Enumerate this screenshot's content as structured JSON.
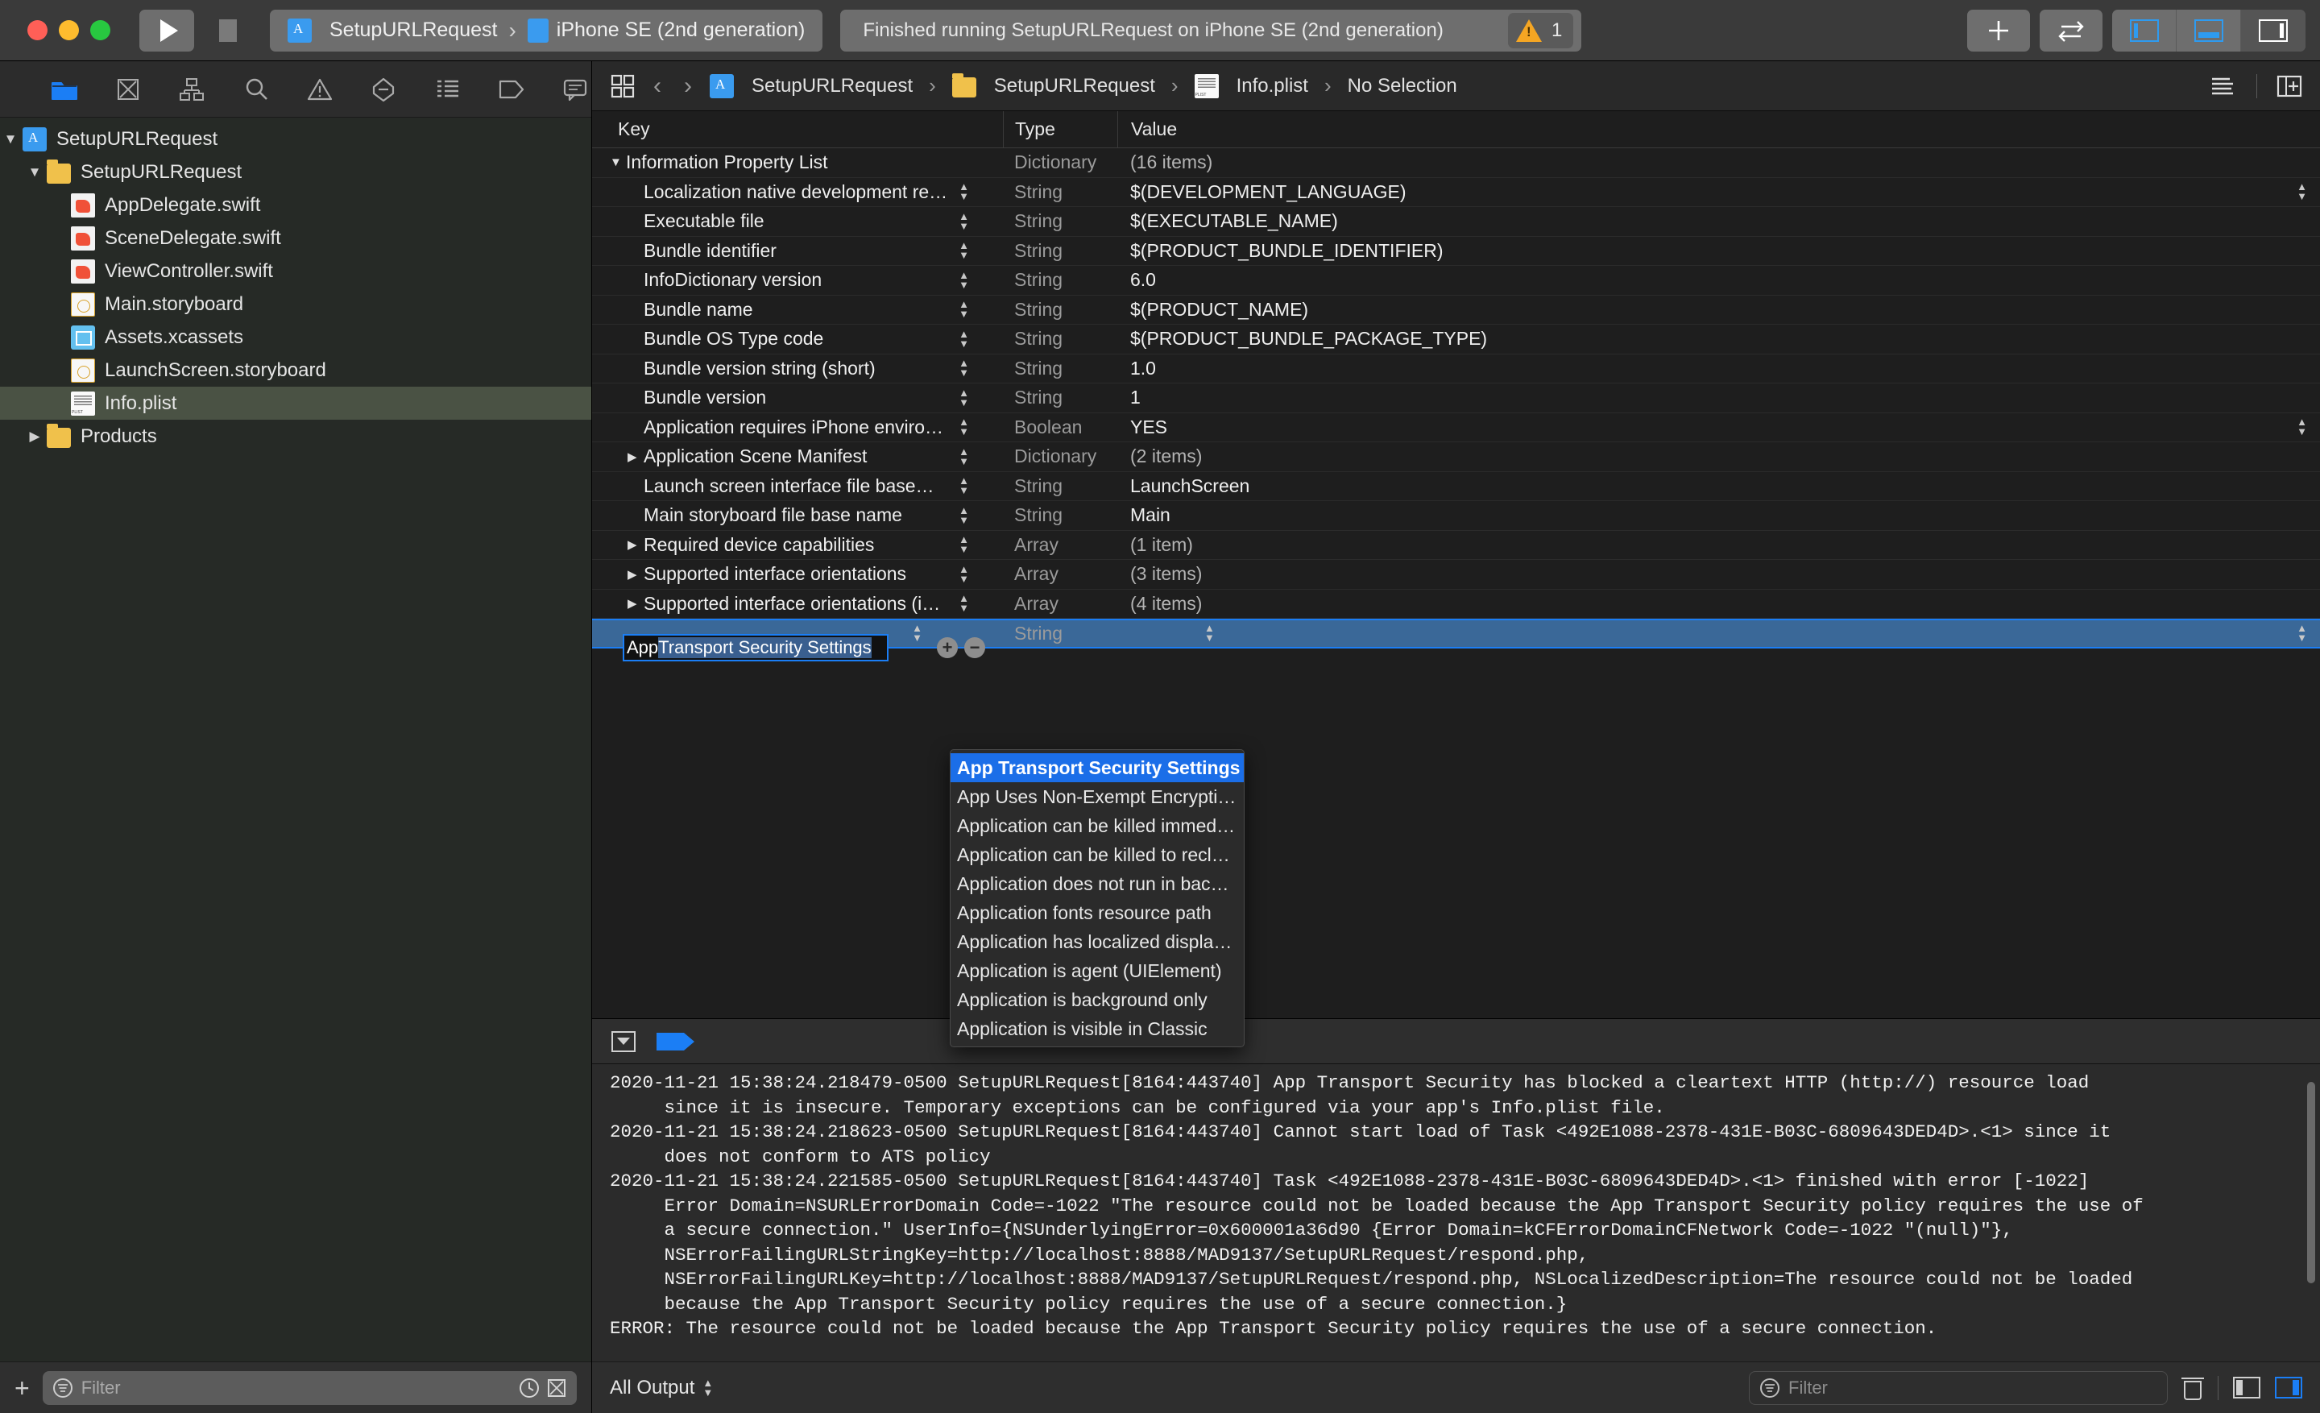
{
  "titlebar": {
    "run_label": "run-button",
    "stop_label": "stop-button",
    "scheme_project": "SetupURLRequest",
    "scheme_separator": "›",
    "scheme_destination": "iPhone SE (2nd generation)",
    "status_text": "Finished running SetupURLRequest on iPhone SE (2nd generation)",
    "warning_count": "1",
    "add_button": "+",
    "toolbar_icons": [
      "plus-icon",
      "swap-icon",
      "left-panel-icon",
      "bottom-panel-icon",
      "right-panel-icon"
    ]
  },
  "navigator": {
    "tabs": [
      "folder-icon",
      "source-control-icon",
      "hierarchy-icon",
      "search-icon",
      "warning-icon",
      "breakpoint-icon",
      "report-icon",
      "tag-icon",
      "comment-icon"
    ],
    "active_tab_index": 0,
    "tree": [
      {
        "label": "SetupURLRequest",
        "icon": "xcodeproj-icon",
        "depth": 0,
        "twisty": "▼",
        "selected": false
      },
      {
        "label": "SetupURLRequest",
        "icon": "folder-icon",
        "depth": 1,
        "twisty": "▼",
        "selected": false
      },
      {
        "label": "AppDelegate.swift",
        "icon": "swift-icon",
        "depth": 2,
        "twisty": "",
        "selected": false
      },
      {
        "label": "SceneDelegate.swift",
        "icon": "swift-icon",
        "depth": 2,
        "twisty": "",
        "selected": false
      },
      {
        "label": "ViewController.swift",
        "icon": "swift-icon",
        "depth": 2,
        "twisty": "",
        "selected": false
      },
      {
        "label": "Main.storyboard",
        "icon": "storyboard-icon",
        "depth": 2,
        "twisty": "",
        "selected": false
      },
      {
        "label": "Assets.xcassets",
        "icon": "xcassets-icon",
        "depth": 2,
        "twisty": "",
        "selected": false
      },
      {
        "label": "LaunchScreen.storyboard",
        "icon": "storyboard-icon",
        "depth": 2,
        "twisty": "",
        "selected": false
      },
      {
        "label": "Info.plist",
        "icon": "plist-icon",
        "depth": 2,
        "twisty": "",
        "selected": true
      },
      {
        "label": "Products",
        "icon": "folder-icon",
        "depth": 1,
        "twisty": "▶",
        "selected": false
      }
    ],
    "bottom": {
      "add_label": "+",
      "filter_placeholder": "Filter",
      "recent_icon": "clock-icon",
      "sourcecontrol_icon": "source-control-filter-icon"
    }
  },
  "editor": {
    "jumpbar": {
      "grid_icon": "related-items-icon",
      "back_arrow": "‹",
      "forward_arrow": "›",
      "breadcrumb": [
        {
          "label": "SetupURLRequest",
          "icon": "xcodeproj-icon"
        },
        {
          "label": "SetupURLRequest",
          "icon": "folder-icon"
        },
        {
          "label": "Info.plist",
          "icon": "plist-icon"
        },
        {
          "label": "No Selection",
          "icon": ""
        }
      ],
      "separator": "›",
      "right_icons": [
        "text-lines-icon",
        "add-editor-icon"
      ]
    },
    "table": {
      "columns": [
        "Key",
        "Type",
        "Value"
      ],
      "rows": [
        {
          "key": "Information Property List",
          "type": "Dictionary",
          "value": "(16 items)",
          "twisty": "▼",
          "indent": 0,
          "stepper": false,
          "dim_value": true,
          "dim_type": true
        },
        {
          "key": "Localization native development re…",
          "type": "String",
          "value": "$(DEVELOPMENT_LANGUAGE)",
          "twisty": "",
          "indent": 1,
          "stepper": true,
          "dim_value": false,
          "dim_type": true,
          "value_stepper": true
        },
        {
          "key": "Executable file",
          "type": "String",
          "value": "$(EXECUTABLE_NAME)",
          "twisty": "",
          "indent": 1,
          "stepper": true,
          "dim_value": false,
          "dim_type": true
        },
        {
          "key": "Bundle identifier",
          "type": "String",
          "value": "$(PRODUCT_BUNDLE_IDENTIFIER)",
          "twisty": "",
          "indent": 1,
          "stepper": true,
          "dim_value": false,
          "dim_type": true
        },
        {
          "key": "InfoDictionary version",
          "type": "String",
          "value": "6.0",
          "twisty": "",
          "indent": 1,
          "stepper": true,
          "dim_value": false,
          "dim_type": true
        },
        {
          "key": "Bundle name",
          "type": "String",
          "value": "$(PRODUCT_NAME)",
          "twisty": "",
          "indent": 1,
          "stepper": true,
          "dim_value": false,
          "dim_type": true
        },
        {
          "key": "Bundle OS Type code",
          "type": "String",
          "value": "$(PRODUCT_BUNDLE_PACKAGE_TYPE)",
          "twisty": "",
          "indent": 1,
          "stepper": true,
          "dim_value": false,
          "dim_type": true
        },
        {
          "key": "Bundle version string (short)",
          "type": "String",
          "value": "1.0",
          "twisty": "",
          "indent": 1,
          "stepper": true,
          "dim_value": false,
          "dim_type": true
        },
        {
          "key": "Bundle version",
          "type": "String",
          "value": "1",
          "twisty": "",
          "indent": 1,
          "stepper": true,
          "dim_value": false,
          "dim_type": true
        },
        {
          "key": "Application requires iPhone enviro…",
          "type": "Boolean",
          "value": "YES",
          "twisty": "",
          "indent": 1,
          "stepper": true,
          "dim_value": false,
          "dim_type": true,
          "value_stepper": true
        },
        {
          "key": "Application Scene Manifest",
          "type": "Dictionary",
          "value": "(2 items)",
          "twisty": "▶",
          "indent": 1,
          "stepper": true,
          "dim_value": true,
          "dim_type": true
        },
        {
          "key": "Launch screen interface file base…",
          "type": "String",
          "value": "LaunchScreen",
          "twisty": "",
          "indent": 1,
          "stepper": true,
          "dim_value": false,
          "dim_type": true
        },
        {
          "key": "Main storyboard file base name",
          "type": "String",
          "value": "Main",
          "twisty": "",
          "indent": 1,
          "stepper": true,
          "dim_value": false,
          "dim_type": true
        },
        {
          "key": "Required device capabilities",
          "type": "Array",
          "value": "(1 item)",
          "twisty": "▶",
          "indent": 1,
          "stepper": true,
          "dim_value": true,
          "dim_type": true
        },
        {
          "key": "Supported interface orientations",
          "type": "Array",
          "value": "(3 items)",
          "twisty": "▶",
          "indent": 1,
          "stepper": true,
          "dim_value": true,
          "dim_type": true
        },
        {
          "key": "Supported interface orientations (i…",
          "type": "Array",
          "value": "(4 items)",
          "twisty": "▶",
          "indent": 1,
          "stepper": true,
          "dim_value": true,
          "dim_type": true
        }
      ],
      "editing_row": {
        "typed_text": "App ",
        "autocompleted_text": "Transport Security Settings",
        "type": "String",
        "value": "",
        "add_button": "+",
        "remove_button": "−"
      },
      "dropdown": {
        "items": [
          "App Transport Security Settings",
          "App Uses Non-Exempt Encrypti…",
          "Application can be killed immed…",
          "Application can be killed to recl…",
          "Application does not run in bac…",
          "Application fonts resource path",
          "Application has localized displa…",
          "Application is agent (UIElement)",
          "Application is background only",
          "Application is visible in Classic"
        ],
        "selected_index": 0
      }
    }
  },
  "debug": {
    "toolbar": {
      "hide_icon": "disclosure-down-icon",
      "breakpoint_icon": "breakpoint-flag-icon"
    },
    "console_output": "2020-11-21 15:38:24.218479-0500 SetupURLRequest[8164:443740] App Transport Security has blocked a cleartext HTTP (http://) resource load\n     since it is insecure. Temporary exceptions can be configured via your app's Info.plist file.\n2020-11-21 15:38:24.218623-0500 SetupURLRequest[8164:443740] Cannot start load of Task <492E1088-2378-431E-B03C-6809643DED4D>.<1> since it\n     does not conform to ATS policy\n2020-11-21 15:38:24.221585-0500 SetupURLRequest[8164:443740] Task <492E1088-2378-431E-B03C-6809643DED4D>.<1> finished with error [-1022]\n     Error Domain=NSURLErrorDomain Code=-1022 \"The resource could not be loaded because the App Transport Security policy requires the use of\n     a secure connection.\" UserInfo={NSUnderlyingError=0x600001a36d90 {Error Domain=kCFErrorDomainCFNetwork Code=-1022 \"(null)\"},\n     NSErrorFailingURLStringKey=http://localhost:8888/MAD9137/SetupURLRequest/respond.php,\n     NSErrorFailingURLKey=http://localhost:8888/MAD9137/SetupURLRequest/respond.php, NSLocalizedDescription=The resource could not be loaded\n     because the App Transport Security policy requires the use of a secure connection.}\nERROR: The resource could not be loaded because the App Transport Security policy requires the use of a secure connection.",
    "bottom": {
      "scope_label": "All Output",
      "filter_placeholder": "Filter",
      "trash_icon": "trash-icon",
      "variables_pane_icon": "variables-pane-icon",
      "console-pane_icon": "console-pane-icon"
    }
  },
  "colors": {
    "accent_blue": "#1b7ef5",
    "selection_blue": "#3a6898",
    "dropdown_blue": "#1b6ee8",
    "warning_yellow": "#f5a623",
    "nav_selected": "#4a5244"
  }
}
